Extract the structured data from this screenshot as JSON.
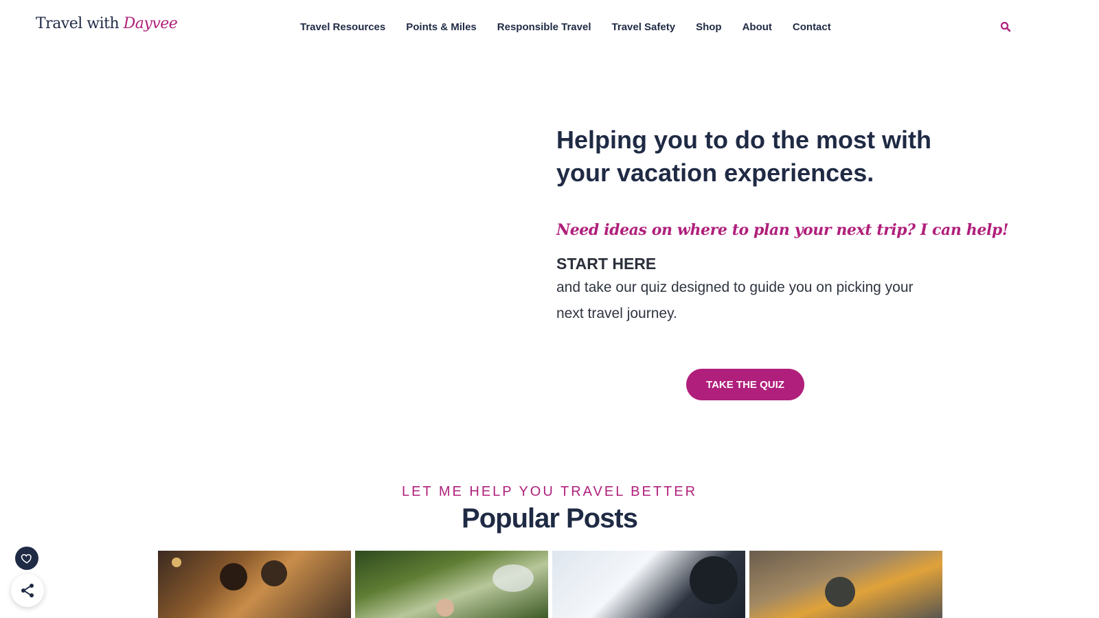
{
  "header": {
    "logo_text": "Travel with",
    "logo_accent": "Dayvee",
    "nav": [
      "Travel Resources",
      "Points & Miles",
      "Responsible Travel",
      "Travel Safety",
      "Shop",
      "About",
      "Contact"
    ]
  },
  "hero": {
    "headline": "Helping you to do the most with your vacation experiences.",
    "tagline": "Need ideas on where to plan your next trip? I can help!",
    "start_label": "START HERE",
    "description": "and take our quiz designed to guide you on picking your next travel journey.",
    "cta_label": "TAKE THE QUIZ"
  },
  "popular": {
    "kicker": "LET ME HELP YOU TRAVEL BETTER",
    "title": "Popular Posts"
  },
  "colors": {
    "brand": "#b01f7b",
    "navy": "#1f2a44"
  }
}
